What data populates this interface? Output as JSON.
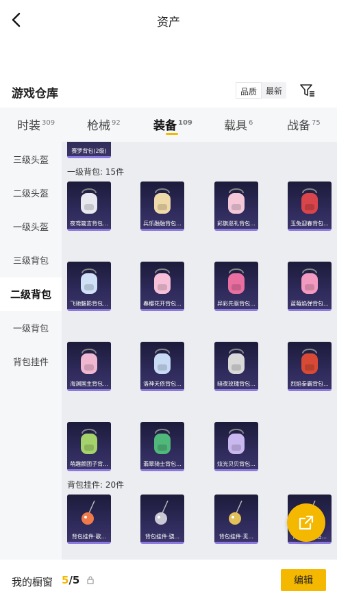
{
  "header": {
    "title": "资产"
  },
  "section": {
    "title": "游戏仓库",
    "sort_quality": "品质",
    "sort_latest": "最新"
  },
  "tabs": [
    {
      "label": "时装",
      "count": "309"
    },
    {
      "label": "枪械",
      "count": "92"
    },
    {
      "label": "装备",
      "count": "109"
    },
    {
      "label": "载具",
      "count": "6"
    },
    {
      "label": "战备",
      "count": "75"
    }
  ],
  "sidebar": {
    "items": [
      "三级头盔",
      "二级头盔",
      "一级头盔",
      "三级背包",
      "二级背包",
      "一级背包",
      "背包挂件"
    ],
    "active": "二级背包"
  },
  "content": {
    "top_item": "赛罗背包(2级)",
    "group1_label": "一级背包: 15件",
    "group1_items": [
      "夜鸢箴言背包...",
      "兵乐融融背包...",
      "彩旗巡礼背包...",
      "玉兔迎春背包...",
      "飞驰魅影背包...",
      "春樱花开背包...",
      "异彩先驱背包...",
      "蓝莓焰弹背包...",
      "海渊国主背包...",
      "洛神天依背包...",
      "暗夜玫瑰背包...",
      "烈焰拳霸背包...",
      "萌趣颜团子背...",
      "翡翠骑士背包...",
      "炫光贝贝背包..."
    ],
    "group2_label": "背包挂件: 20件",
    "group2_items": [
      "背包挂件·歌...",
      "背包挂件·骁...",
      "背包挂件·觅...",
      "背包挂件·悠..."
    ]
  },
  "footer": {
    "showcase_label": "我的橱窗",
    "showcase_used": "5",
    "showcase_total": "/5",
    "edit_label": "编辑"
  },
  "colors": {
    "accent": "#f5b800",
    "card_bg": "#2e2a5a",
    "card_border": "#8c79e0"
  }
}
